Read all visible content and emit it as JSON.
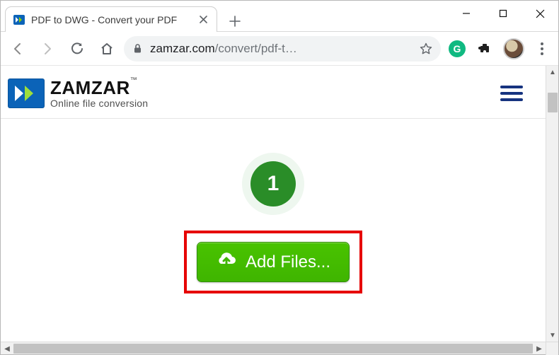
{
  "window": {
    "tab_title": "PDF to DWG - Convert your PDF"
  },
  "addressbar": {
    "domain": "zamzar.com",
    "path": "/convert/pdf-t…"
  },
  "site": {
    "brand": "ZAMZAR",
    "trademark": "™",
    "tagline": "Online file conversion"
  },
  "main": {
    "step_number": "1",
    "add_files_label": "Add Files..."
  },
  "colors": {
    "highlight_box": "#e60000",
    "button_bg": "#49c300",
    "step_badge": "#2a8d28",
    "brand_blue": "#0b63b8"
  }
}
